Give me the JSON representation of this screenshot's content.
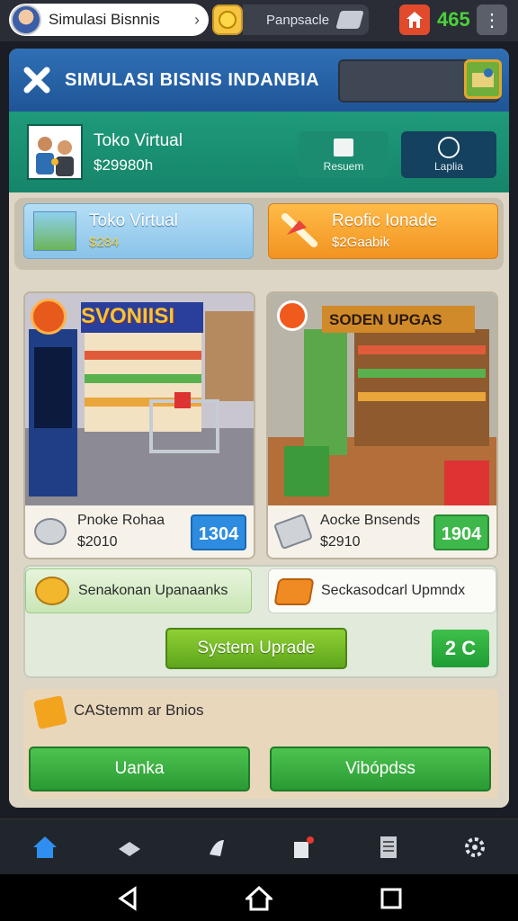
{
  "top_bar": {
    "active_tab_label": "Simulasi Bisnnis",
    "second_tab_label": "Panpsacle",
    "coins": "465"
  },
  "header": {
    "title": "SIMULASI BISNIS INDANBIA"
  },
  "shop": {
    "name": "Toko Virtual",
    "money": "$29980h",
    "resume_label": "Resuem",
    "report_label": "Laplia"
  },
  "summary_cards": [
    {
      "title": "Toko Virtual",
      "value": "$284"
    },
    {
      "title": "Reofic Ionade",
      "value": "$2Gaabik"
    }
  ],
  "stores": [
    {
      "sign": "SVONIISI",
      "name": "Pnoke Rohaa",
      "price": "$2010",
      "button": "1304"
    },
    {
      "sign": "SODEN UPGAS",
      "name": "Aocke Bnsends",
      "price": "$2910",
      "button": "1904"
    }
  ],
  "upgrades": {
    "left_label": "Senakonan Upanaanks",
    "right_label": "Seckasodcarl Upmndx",
    "system_upgrade_label": "System Uprade",
    "count_label": "2 C"
  },
  "customers": {
    "label": "CAStemm ar Bnios",
    "button_left": "Uanka",
    "button_right": "Vibópdss"
  },
  "colors": {
    "header_blue": "#2f6fb5",
    "shop_teal": "#1e9a7a",
    "coin_green": "#4cd13a",
    "button_green": "#3fb446",
    "accent_orange": "#f29321"
  },
  "icons": {
    "nav": [
      "home-icon",
      "stack-icon",
      "arrow-icon",
      "bag-icon",
      "list-icon",
      "settings-icon"
    ],
    "system": [
      "back-icon",
      "home-circle-icon",
      "recents-icon"
    ]
  }
}
